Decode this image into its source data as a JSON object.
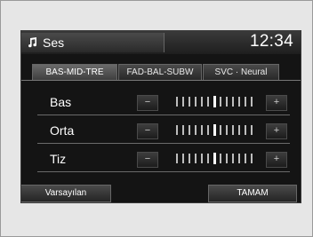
{
  "header": {
    "title": "Ses",
    "clock": "12:34",
    "icon": "music-note-icon"
  },
  "tabs": [
    {
      "label": "BAS-MID-TRE",
      "active": true
    },
    {
      "label": "FAD-BAL-SUBW",
      "active": false
    },
    {
      "label": "SVC · Neural",
      "active": false
    }
  ],
  "rows": [
    {
      "label": "Bas",
      "minus": "−",
      "plus": "+",
      "level": 0.5
    },
    {
      "label": "Orta",
      "minus": "−",
      "plus": "+",
      "level": 0.5
    },
    {
      "label": "Tiz",
      "minus": "−",
      "plus": "+",
      "level": 0.5
    }
  ],
  "footer": {
    "default_label": "Varsayılan",
    "ok_label": "TAMAM"
  }
}
